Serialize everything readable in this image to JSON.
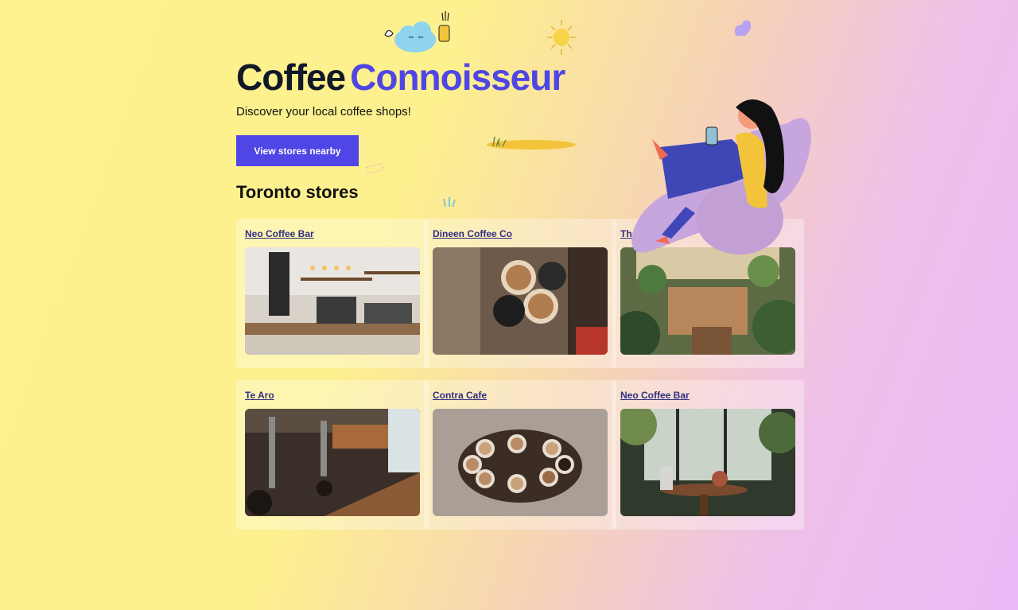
{
  "hero": {
    "title_part1": "Coffee",
    "title_part2": "Connoisseur",
    "subtitle": "Discover your local coffee shops!",
    "button_label": "View stores nearby"
  },
  "section": {
    "title": "Toronto stores"
  },
  "stores": [
    {
      "name": "Neo Coffee Bar",
      "image": "cafe-counter-interior"
    },
    {
      "name": "Dineen Coffee Co",
      "image": "latte-cups-toast"
    },
    {
      "name": "The Landing",
      "image": "plant-filled-patio"
    },
    {
      "name": "Te Aro",
      "image": "industrial-cafe-interior"
    },
    {
      "name": "Contra Cafe",
      "image": "coffee-cups-circle-table"
    },
    {
      "name": "Neo Coffee Bar",
      "image": "greenhouse-cafe-table"
    }
  ],
  "colors": {
    "accent": "#4f46e5",
    "title_dark": "#111827",
    "link": "#312e81"
  },
  "icons": [
    "cloud-icon",
    "coffee-cup-icon",
    "sun-icon",
    "leaf-blob-icon",
    "grass-patch-icon",
    "woman-on-chair-illustration"
  ]
}
